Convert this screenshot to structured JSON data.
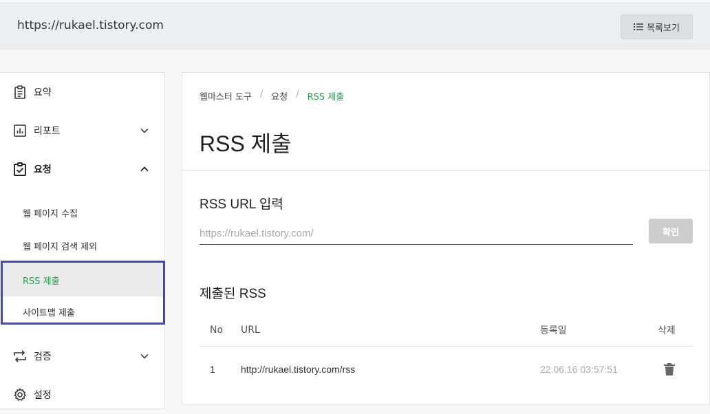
{
  "header": {
    "site_url": "https://rukael.tistory.com",
    "list_button_label": "목록보기"
  },
  "sidebar": {
    "items": [
      {
        "label": "요약",
        "icon": "clipboard-icon"
      },
      {
        "label": "리포트",
        "icon": "bar-chart-icon"
      },
      {
        "label": "요청",
        "icon": "clipboard-check-icon",
        "expanded": true
      },
      {
        "label": "검증",
        "icon": "repeat-icon"
      },
      {
        "label": "설정",
        "icon": "gear-icon"
      }
    ],
    "sub_items": [
      {
        "label": "웹 페이지 수집"
      },
      {
        "label": "웹 페이지 검색 제외"
      },
      {
        "label": "RSS 제출",
        "active": true
      },
      {
        "label": "사이트맵 제출"
      }
    ]
  },
  "breadcrumb": {
    "root": "웹마스터 도구",
    "parent": "요청",
    "current": "RSS 제출",
    "separator": "/"
  },
  "main": {
    "title": "RSS 제출",
    "input_section_title": "RSS URL 입력",
    "input_placeholder": "https://rukael.tistory.com/",
    "confirm_label": "확인",
    "submitted_title": "제출된 RSS",
    "table": {
      "headers": {
        "no": "No",
        "url": "URL",
        "date": "등록일",
        "delete": "삭제"
      },
      "rows": [
        {
          "no": "1",
          "url": "http://rukael.tistory.com/rss",
          "date": "22.06.16 03:57:51"
        }
      ]
    }
  },
  "colors": {
    "accent": "#1fa14c",
    "highlight": "#3f47c8"
  }
}
